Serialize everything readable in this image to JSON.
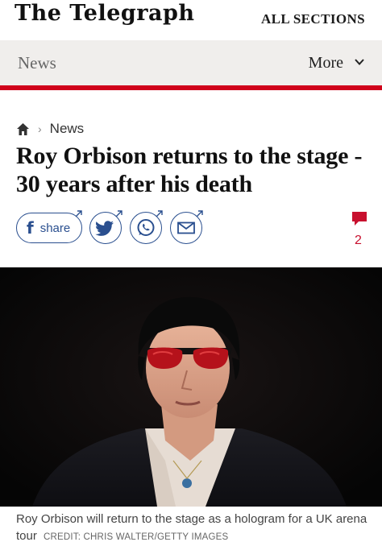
{
  "header": {
    "logo_text": "The Telegraph",
    "sections_label": "ALL SECTIONS"
  },
  "nav": {
    "section_label": "News",
    "more_label": "More"
  },
  "breadcrumb": {
    "home_icon": "home-icon",
    "item": "News"
  },
  "article": {
    "headline": "Roy Orbison returns to the stage - 30 years after his death"
  },
  "share": {
    "facebook_label": "share",
    "icons": [
      "facebook-icon",
      "twitter-icon",
      "whatsapp-icon",
      "email-icon"
    ]
  },
  "comments": {
    "count": "2"
  },
  "image": {
    "caption": "Roy Orbison will return to the stage as a hologram for a UK arena tour",
    "credit": "CREDIT: CHRIS WALTER/GETTY IMAGES"
  },
  "colors": {
    "accent_red": "#d0021b",
    "share_blue": "#2a4f8f",
    "nav_bg": "#f0eeec"
  }
}
